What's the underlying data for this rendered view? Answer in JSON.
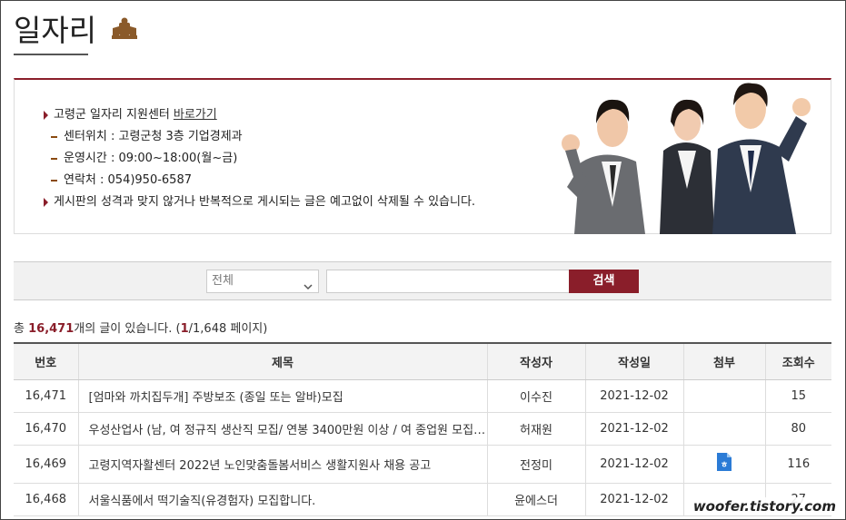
{
  "page": {
    "title": "일자리"
  },
  "info": {
    "center_label": "고령군 일자리 지원센터",
    "center_link": "바로가기",
    "location": "센터위치 : 고령군청 3층 기업경제과",
    "hours": "운영시간 : 09:00~18:00(월~금)",
    "contact": "연락처 : 054)950-6587",
    "notice": "게시판의 성격과 맞지 않거나 반복적으로 게시되는 글은 예고없이 삭제될 수 있습니다."
  },
  "search": {
    "select_value": "전체",
    "query": "",
    "button_label": "검색"
  },
  "count": {
    "prefix": "총",
    "total": "16,471",
    "suffix": "개의 글이 있습니다.",
    "page_current": "1",
    "page_total": "1,648",
    "page_word": "페이지"
  },
  "table": {
    "headers": [
      "번호",
      "제목",
      "작성자",
      "작성일",
      "첨부",
      "조회수"
    ],
    "rows": [
      {
        "no": "16,471",
        "subject": "[엄마와 까치집두개] 주방보조 (종일 또는 알바)모집",
        "author": "이수진",
        "date": "2021-12-02",
        "has_attachment": false,
        "views": "15"
      },
      {
        "no": "16,470",
        "subject": "우성산업사 (남, 여 정규직 생산직 모집/ 연봉 3400만원 이상 / 여 종업원 모집 ...",
        "author": "허재원",
        "date": "2021-12-02",
        "has_attachment": false,
        "views": "80"
      },
      {
        "no": "16,469",
        "subject": "고령지역자활센터 2022년 노인맞춤돌봄서비스 생활지원사 채용 공고",
        "author": "전정미",
        "date": "2021-12-02",
        "has_attachment": true,
        "views": "116"
      },
      {
        "no": "16,468",
        "subject": "서울식품에서 떡기술직(유경험자) 모집합니다.",
        "author": "윤에스더",
        "date": "2021-12-02",
        "has_attachment": false,
        "views": "27"
      }
    ]
  },
  "watermark": "woofer.tistory.com",
  "colors": {
    "accent": "#8a1e2a",
    "header_bg": "#f3f3f3",
    "search_bg": "#f1f1f1"
  }
}
